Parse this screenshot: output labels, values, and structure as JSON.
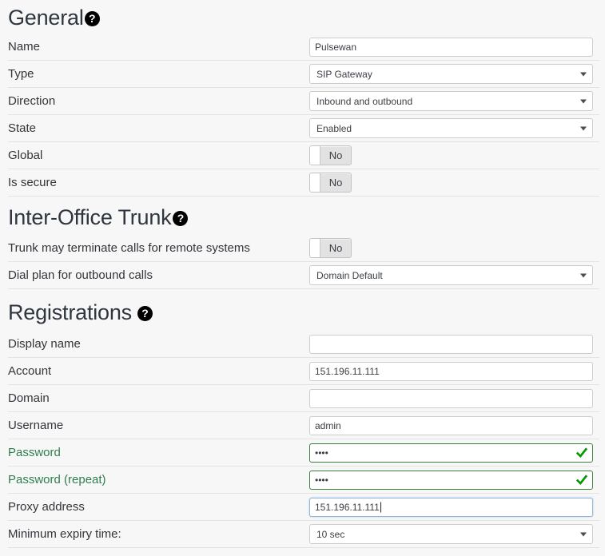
{
  "sections": {
    "general": {
      "title": "General",
      "help_icon": "help-circle-icon",
      "rows": [
        {
          "label": "Name",
          "type": "text",
          "value": "Pulsewan"
        },
        {
          "label": "Type",
          "type": "select",
          "value": "SIP Gateway"
        },
        {
          "label": "Direction",
          "type": "select",
          "value": "Inbound and outbound"
        },
        {
          "label": "State",
          "type": "select",
          "value": "Enabled"
        },
        {
          "label": "Global",
          "type": "toggle",
          "value": "No"
        },
        {
          "label": "Is secure",
          "type": "toggle",
          "value": "No"
        }
      ]
    },
    "trunk": {
      "title": "Inter-Office Trunk",
      "help_icon": "help-circle-icon",
      "rows": [
        {
          "label": "Trunk may terminate calls for remote systems",
          "type": "toggle",
          "value": "No"
        },
        {
          "label": "Dial plan for outbound calls",
          "type": "select",
          "value": "Domain Default"
        }
      ]
    },
    "registrations": {
      "title": "Registrations",
      "help_icon": "help-circle-icon",
      "rows": [
        {
          "label": "Display name",
          "type": "text",
          "value": "",
          "placeholder": ""
        },
        {
          "label": "Account",
          "type": "text",
          "value": "151.196.11.111",
          "placeholder": ""
        },
        {
          "label": "Domain",
          "type": "text",
          "value": "",
          "placeholder": ""
        },
        {
          "label": "Username",
          "type": "text",
          "value": "admin",
          "placeholder": ""
        },
        {
          "label": "Password",
          "type": "password",
          "value": "••••",
          "masked_length": 4,
          "valid": true,
          "label_color": "#2f7d4e"
        },
        {
          "label": "Password (repeat)",
          "type": "password",
          "value": "••••",
          "masked_length": 4,
          "valid": true,
          "label_color": "#2f7d4e"
        },
        {
          "label": "Proxy address",
          "type": "text",
          "value": "151.196.11.111",
          "focused": true
        },
        {
          "label": "Minimum expiry time:",
          "type": "select",
          "value": "10 sec"
        }
      ]
    }
  },
  "colors": {
    "page_background": "#f7f7f7",
    "row_separator": "#e3e3e3",
    "input_border": "#cccccc",
    "valid_border": "#3d7a3d",
    "focus_border": "#8cb4dd",
    "check_green": "#009900",
    "label_text": "#33353a",
    "green_label": "#2f7d4e",
    "heading_text": "#2f3640",
    "toggle_background": "#e2e2e2"
  }
}
